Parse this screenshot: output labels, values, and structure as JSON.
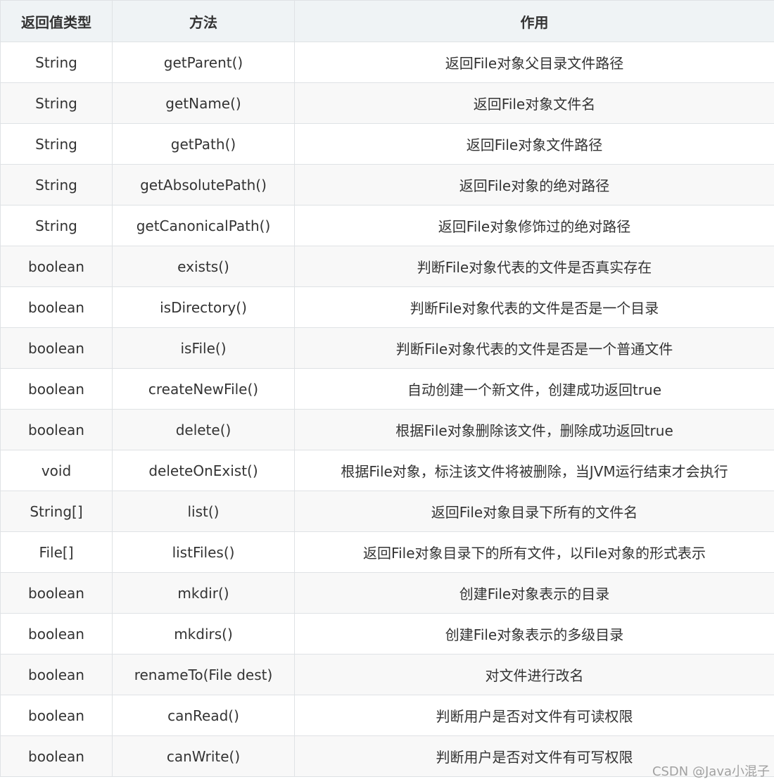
{
  "table": {
    "headers": [
      "返回值类型",
      "方法",
      "作用"
    ],
    "rows": [
      [
        "String",
        "getParent()",
        "返回File对象父目录文件路径"
      ],
      [
        "String",
        "getName()",
        "返回File对象文件名"
      ],
      [
        "String",
        "getPath()",
        "返回File对象文件路径"
      ],
      [
        "String",
        "getAbsolutePath()",
        "返回File对象的绝对路径"
      ],
      [
        "String",
        "getCanonicalPath()",
        "返回File对象修饰过的绝对路径"
      ],
      [
        "boolean",
        "exists()",
        "判断File对象代表的文件是否真实存在"
      ],
      [
        "boolean",
        "isDirectory()",
        "判断File对象代表的文件是否是一个目录"
      ],
      [
        "boolean",
        "isFile()",
        "判断File对象代表的文件是否是一个普通文件"
      ],
      [
        "boolean",
        "createNewFile()",
        "自动创建一个新文件，创建成功返回true"
      ],
      [
        "boolean",
        "delete()",
        "根据File对象删除该文件，删除成功返回true"
      ],
      [
        "void",
        "deleteOnExist()",
        "根据File对象，标注该文件将被删除，当JVM运行结束才会执行"
      ],
      [
        "String[]",
        "list()",
        "返回File对象目录下所有的文件名"
      ],
      [
        "File[]",
        "listFiles()",
        "返回File对象目录下的所有文件，以File对象的形式表示"
      ],
      [
        "boolean",
        "mkdir()",
        "创建File对象表示的目录"
      ],
      [
        "boolean",
        "mkdirs()",
        "创建File对象表示的多级目录"
      ],
      [
        "boolean",
        "renameTo(File dest)",
        "对文件进行改名"
      ],
      [
        "boolean",
        "canRead()",
        "判断用户是否对文件有可读权限"
      ],
      [
        "boolean",
        "canWrite()",
        "判断用户是否对文件有可写权限"
      ]
    ]
  },
  "watermark": "CSDN @Java小混子"
}
